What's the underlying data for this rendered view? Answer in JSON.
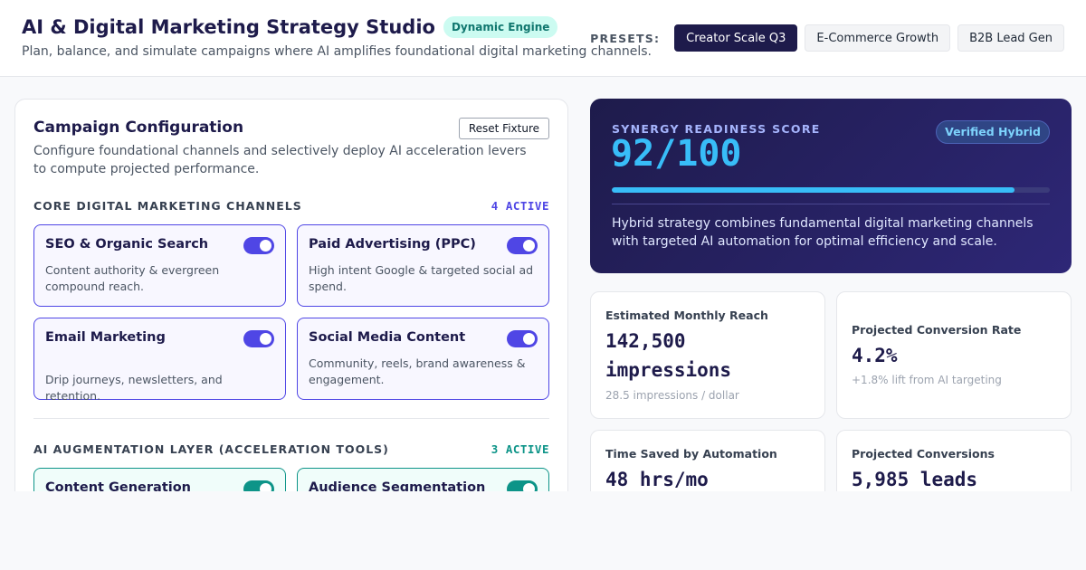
{
  "header": {
    "title": "AI & Digital Marketing Strategy Studio",
    "badge": "Dynamic Engine",
    "subtitle": "Plan, balance, and simulate campaigns where AI amplifies foundational digital marketing channels.",
    "presets_label": "PRESETS:",
    "presets": [
      "Creator Scale Q3",
      "E-Commerce Growth",
      "B2B Lead Gen"
    ],
    "active_preset": "Creator Scale Q3"
  },
  "config": {
    "title": "Campaign Configuration",
    "reset_label": "Reset Fixture",
    "description": "Configure foundational channels and selectively deploy AI acceleration levers to compute projected performance.",
    "core": {
      "label": "CORE DIGITAL MARKETING CHANNELS",
      "count": "4 ACTIVE",
      "channels": [
        {
          "title": "SEO & Organic Search",
          "desc": "Content authority & evergreen compound reach.",
          "enabled": true
        },
        {
          "title": "Paid Advertising (PPC)",
          "desc": "High intent Google & targeted social ad spend.",
          "enabled": true
        },
        {
          "title": "Email Marketing",
          "desc": "Drip journeys, newsletters, and retention.",
          "enabled": true
        },
        {
          "title": "Social Media Content",
          "desc": "Community, reels, brand awareness & engagement.",
          "enabled": true
        }
      ]
    },
    "ai": {
      "label": "AI AUGMENTATION LAYER (ACCELERATION TOOLS)",
      "count": "3 ACTIVE",
      "tools": [
        {
          "title": "Content Generation",
          "enabled": true
        },
        {
          "title": "Audience Segmentation",
          "enabled": true
        }
      ]
    }
  },
  "score": {
    "label": "SYNERGY READINESS SCORE",
    "value_text": "92/100",
    "value": 92,
    "max": 100,
    "badge": "Verified Hybrid",
    "note": "Hybrid strategy combines fundamental digital marketing channels with targeted AI automation for optimal efficiency and scale."
  },
  "metrics": {
    "reach": {
      "label": "Estimated Monthly Reach",
      "value": "142,500 impressions",
      "sub": "28.5 impressions / dollar"
    },
    "conversion": {
      "label": "Projected Conversion Rate",
      "value": "4.2%",
      "sub": "+1.8% lift from AI targeting"
    },
    "time_saved": {
      "label": "Time Saved by Automation",
      "value": "48 hrs/mo"
    },
    "conversions": {
      "label": "Projected Conversions",
      "value": "5,985 leads"
    }
  },
  "colors": {
    "primary": "#1e1b4b",
    "core_accent": "#4f46e5",
    "ai_accent": "#0d9488",
    "score_accent": "#38bdf8"
  }
}
